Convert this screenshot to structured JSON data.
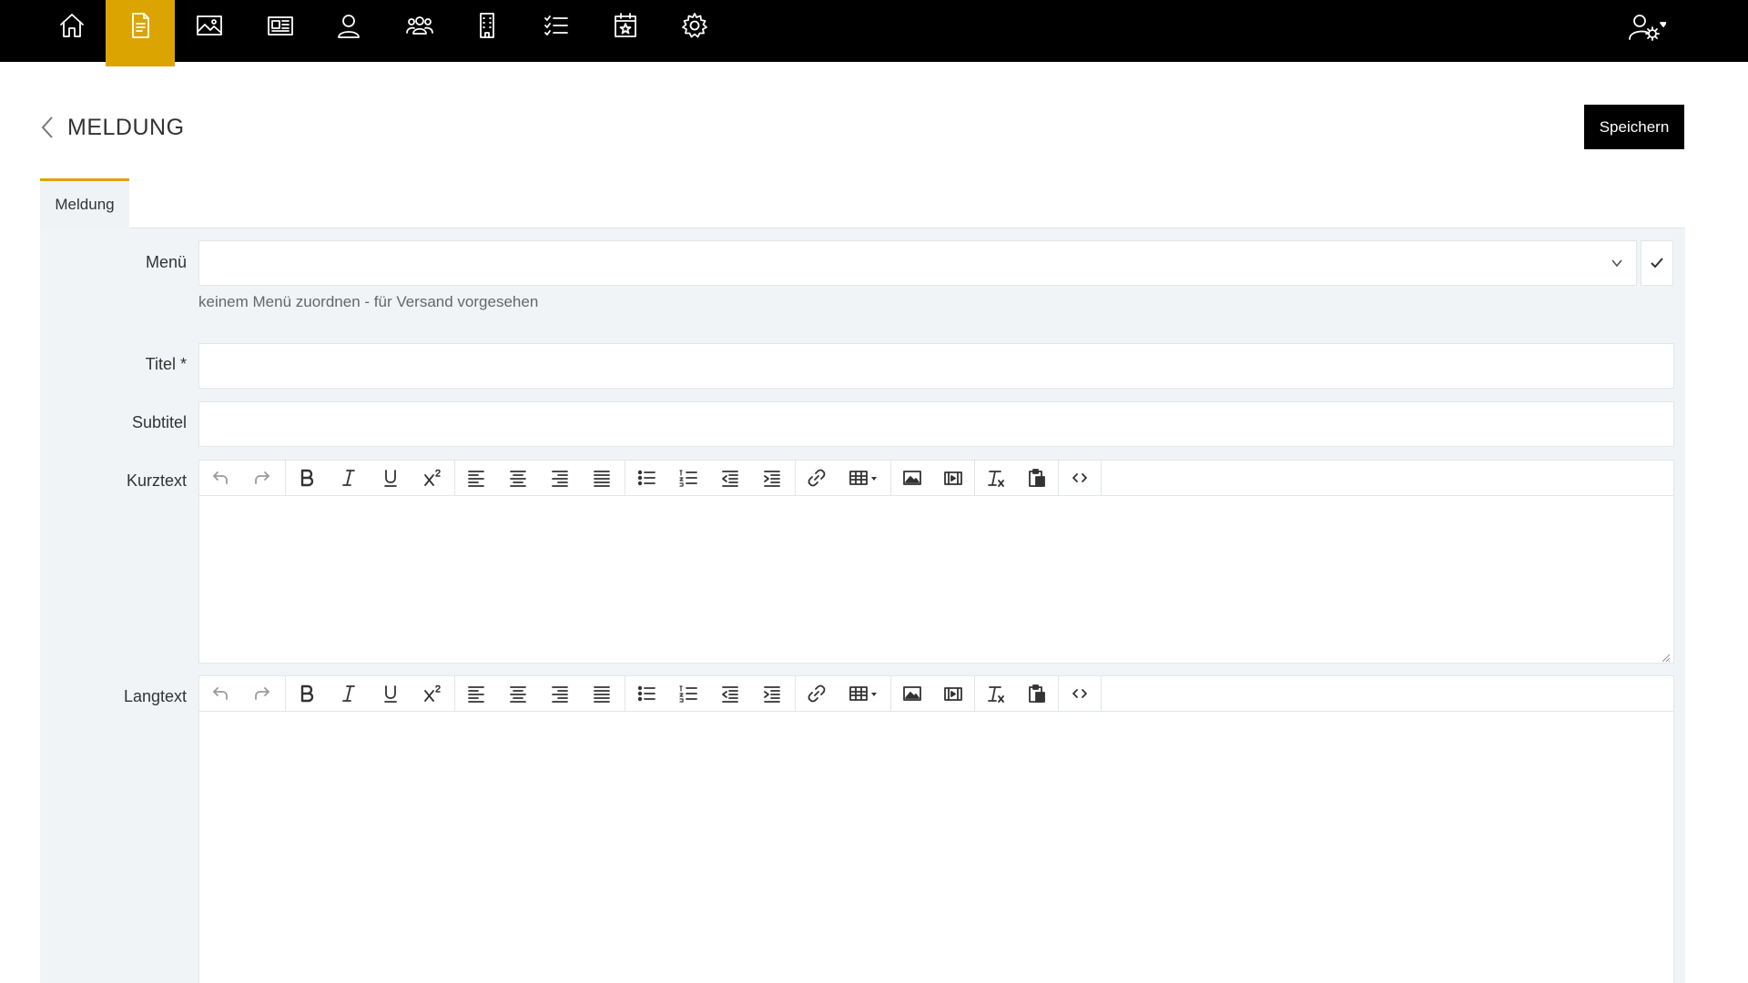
{
  "nav": {
    "items": [
      {
        "icon": "home-icon"
      },
      {
        "icon": "document-icon",
        "active": true
      },
      {
        "icon": "image-icon"
      },
      {
        "icon": "newspaper-icon"
      },
      {
        "icon": "user-icon"
      },
      {
        "icon": "users-group-icon"
      },
      {
        "icon": "building-icon"
      },
      {
        "icon": "checklist-icon"
      },
      {
        "icon": "calendar-star-icon"
      },
      {
        "icon": "gear-icon"
      }
    ],
    "user_menu_icon": "user-settings-icon",
    "accent_color": "#dba400"
  },
  "header": {
    "title": "MELDUNG",
    "save_label": "Speichern"
  },
  "tabs": [
    {
      "label": "Meldung",
      "active": true
    }
  ],
  "form": {
    "menu_label": "Menü",
    "menu_value": "",
    "menu_hint": "keinem Menü zuordnen - für Versand vorgesehen",
    "title_label": "Titel *",
    "title_value": "",
    "subtitle_label": "Subtitel",
    "subtitle_value": "",
    "kurztext_label": "Kurztext",
    "langtext_label": "Langtext"
  },
  "editor_toolbar": [
    [
      "undo-icon",
      "redo-icon"
    ],
    [
      "bold-icon",
      "italic-icon",
      "underline-icon",
      "superscript-icon"
    ],
    [
      "align-left-icon",
      "align-center-icon",
      "align-right-icon",
      "align-justify-icon"
    ],
    [
      "bullet-list-icon",
      "numbered-list-icon",
      "outdent-icon",
      "indent-icon"
    ],
    [
      "link-icon",
      "table-icon"
    ],
    [
      "insert-image-icon",
      "insert-media-icon"
    ],
    [
      "clear-format-icon",
      "paste-text-icon"
    ],
    [
      "source-code-icon"
    ]
  ]
}
